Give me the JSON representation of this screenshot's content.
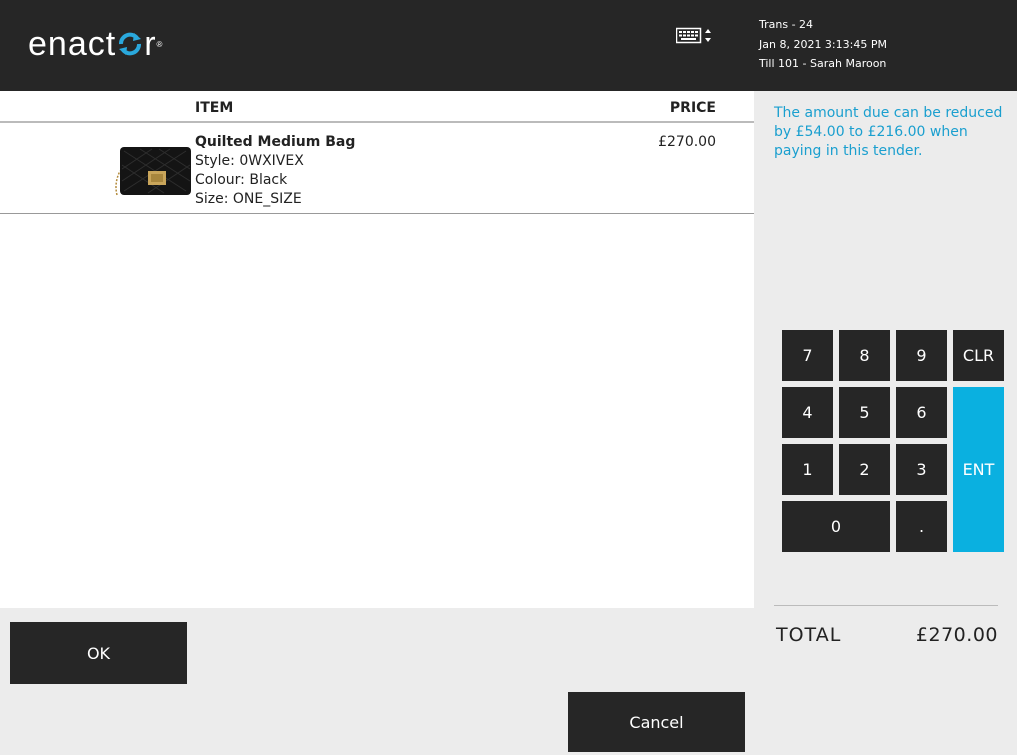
{
  "header": {
    "logo_text": "enactor",
    "keyboard_icon": "keyboard-toggle-icon",
    "trans": "Trans - 24",
    "datetime": "Jan 8, 2021 3:13:45 PM",
    "till": "Till 101 - Sarah Maroon"
  },
  "table": {
    "col_item": "ITEM",
    "col_price": "PRICE",
    "rows": [
      {
        "name": "Quilted Medium Bag",
        "style": "Style: 0WXIVEX",
        "colour": "Colour: Black",
        "size": "Size: ONE_SIZE",
        "price": "£270.00",
        "image_icon": "handbag-image"
      }
    ]
  },
  "promo_text": "The amount due can be reduced by £54.00 to £216.00 when paying in this tender.",
  "keypad": {
    "k7": "7",
    "k8": "8",
    "k9": "9",
    "clr": "CLR",
    "k4": "4",
    "k5": "5",
    "k6": "6",
    "k1": "1",
    "k2": "2",
    "k3": "3",
    "ent": "ENT",
    "k0": "0",
    "dot": "."
  },
  "total": {
    "label": "TOTAL",
    "value": "£270.00"
  },
  "buttons": {
    "ok": "OK",
    "cancel": "Cancel"
  },
  "colors": {
    "dark": "#262626",
    "accent": "#0ab0e0",
    "promo": "#1a9fcf"
  }
}
